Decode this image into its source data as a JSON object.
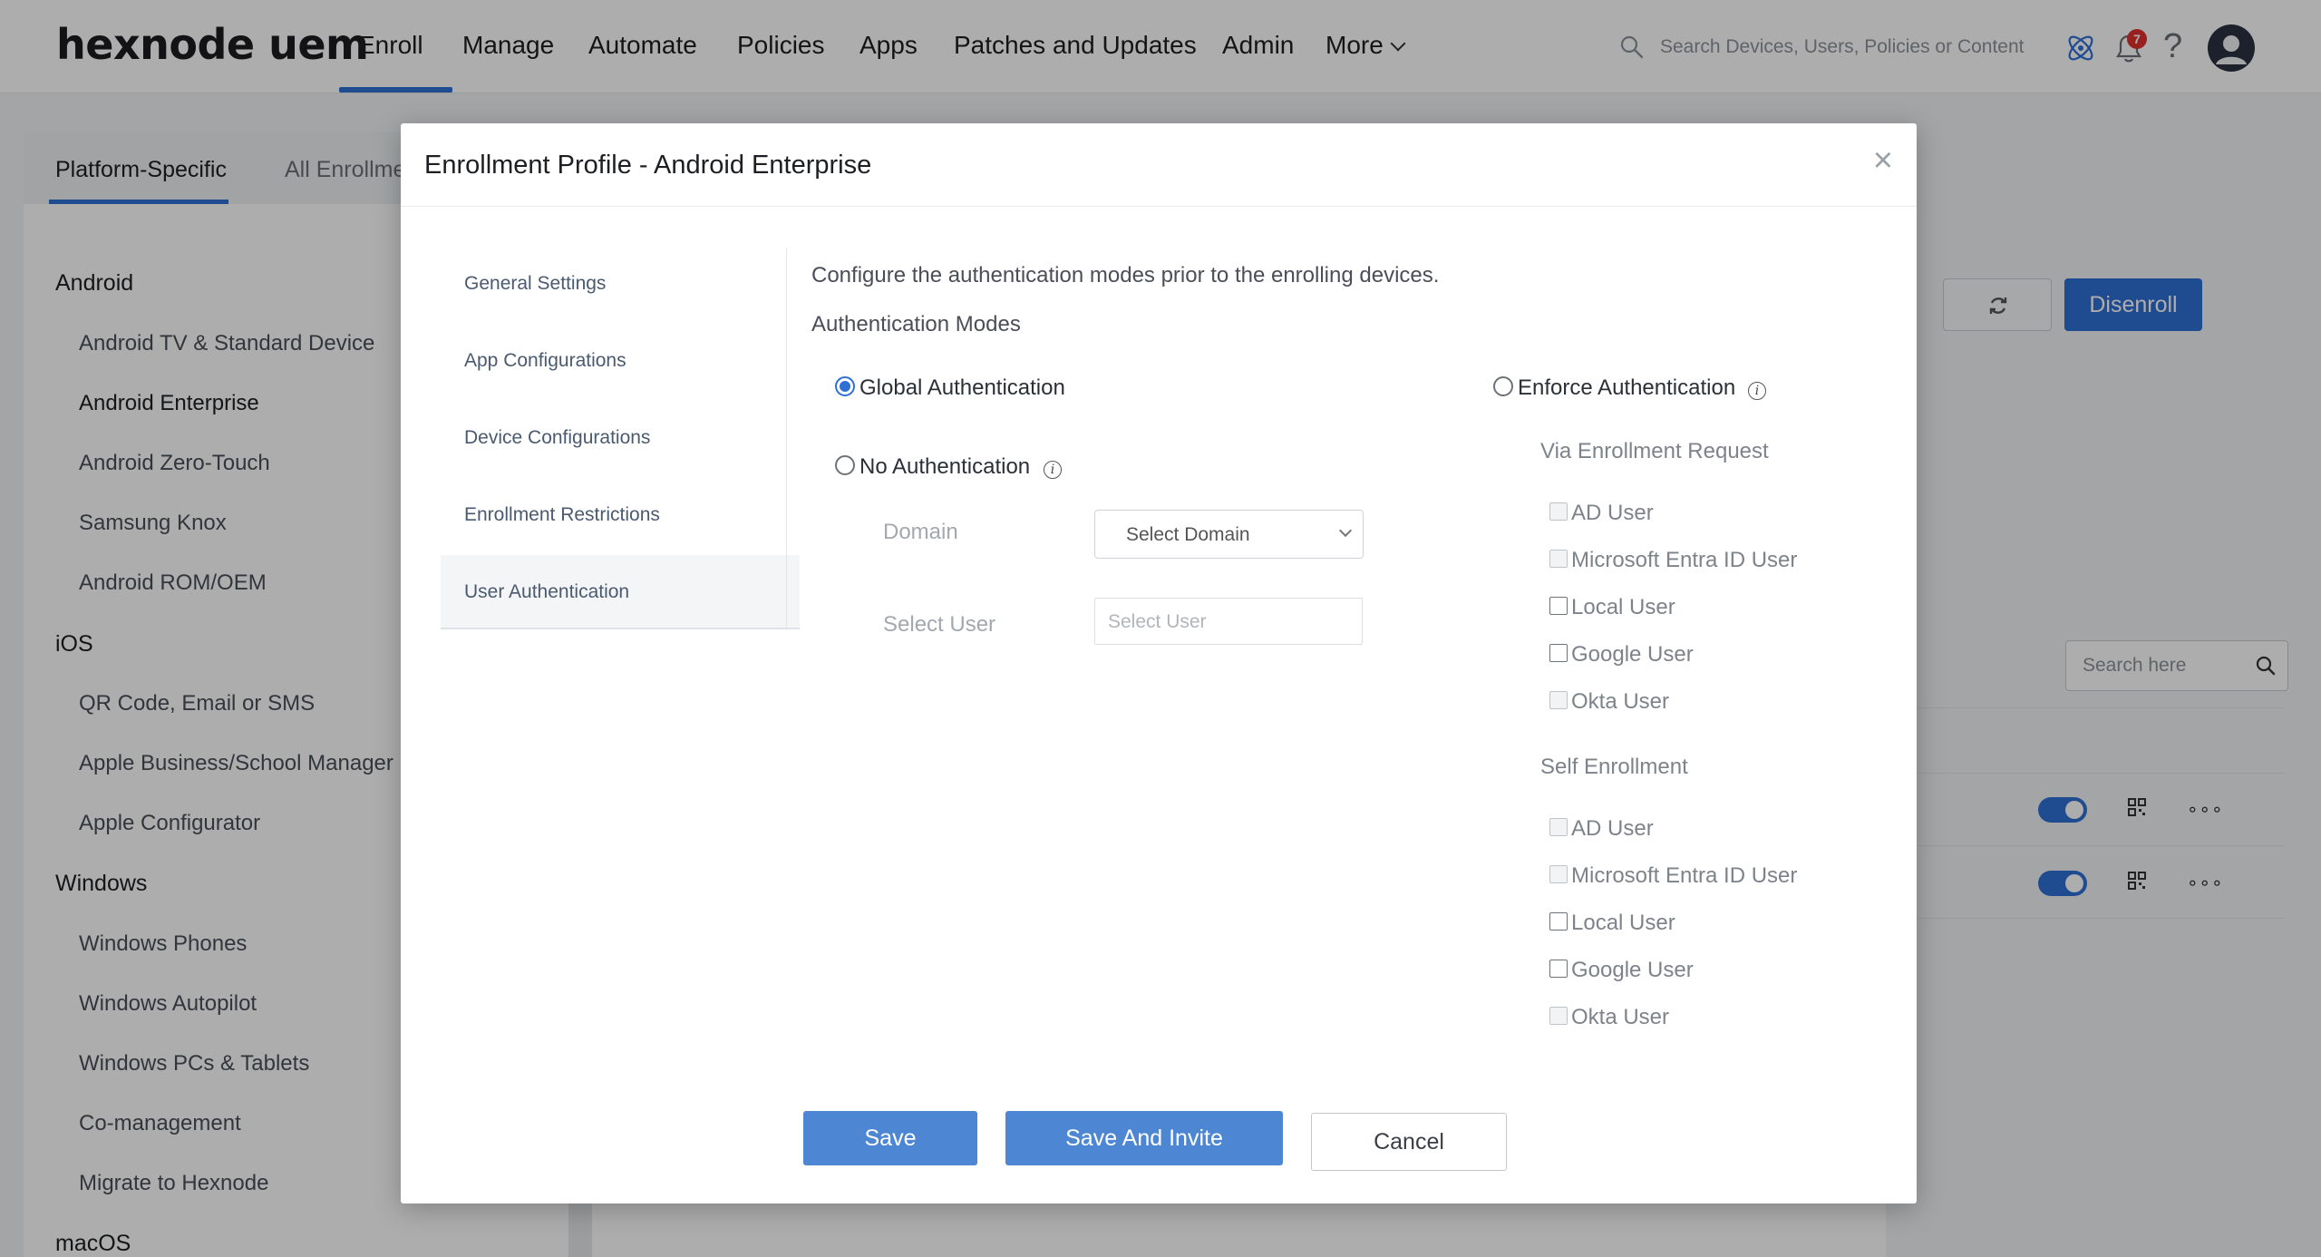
{
  "header": {
    "logo": "hexnode uem",
    "nav": [
      "Enroll",
      "Manage",
      "Automate",
      "Policies",
      "Apps",
      "Patches and Updates",
      "Admin"
    ],
    "more_label": "More",
    "search_placeholder": "Search Devices, Users, Policies or Content",
    "notification_count": "7"
  },
  "page": {
    "tabs": [
      "Platform-Specific",
      "All Enrollme"
    ],
    "sidebar": {
      "android_head": "Android",
      "android_items": [
        "Android TV & Standard Device",
        "Android Enterprise",
        "Android Zero-Touch",
        "Samsung Knox",
        "Android ROM/OEM"
      ],
      "ios_head": "iOS",
      "ios_items": [
        "QR Code, Email or SMS",
        "Apple Business/School Manager",
        "Apple Configurator"
      ],
      "windows_head": "Windows",
      "windows_items": [
        "Windows Phones",
        "Windows Autopilot",
        "Windows PCs & Tablets",
        "Co-management",
        "Migrate to Hexnode"
      ],
      "macos_head": "macOS"
    },
    "disenroll_label": "Disenroll",
    "search_placeholder": "Search here"
  },
  "modal": {
    "title": "Enrollment Profile - Android Enterprise",
    "close": "×",
    "nav": [
      "General Settings",
      "App Configurations",
      "Device Configurations",
      "Enrollment Restrictions",
      "User Authentication"
    ],
    "active_nav": "User Authentication",
    "description": "Configure the authentication modes prior to the enrolling devices.",
    "auth_modes_label": "Authentication Modes",
    "global_auth": "Global Authentication",
    "no_auth": "No Authentication",
    "enforce_auth": "Enforce Authentication",
    "selected_mode": "Global Authentication",
    "domain_label": "Domain",
    "domain_select": "Select Domain",
    "select_user_label": "Select User",
    "select_user_placeholder": "Select User",
    "via_enrollment_request": "Via Enrollment Request",
    "self_enrollment": "Self Enrollment",
    "user_types": [
      "AD User",
      "Microsoft Entra ID User",
      "Local User",
      "Google User",
      "Okta User"
    ],
    "buttons": {
      "save": "Save",
      "save_invite": "Save And Invite",
      "cancel": "Cancel"
    }
  },
  "colors": {
    "accent": "#2f6fd6",
    "primary_button": "#4d87d4",
    "badge": "#e0312f"
  }
}
